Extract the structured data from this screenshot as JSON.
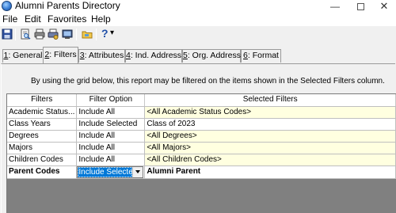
{
  "window": {
    "title": "Alumni Parents Directory",
    "minimize_glyph": "—",
    "close_glyph": "✕"
  },
  "menu": {
    "items": [
      "File",
      "Edit",
      "Favorites",
      "Help"
    ]
  },
  "toolbar": {
    "icons": [
      "save-icon",
      "print-preview-icon",
      "print-icon",
      "print-setup-icon",
      "export-icon",
      "folder-icon",
      "help-icon",
      "dropdown-arrow-icon"
    ],
    "help_glyph": "?",
    "dropdown_glyph": "▾"
  },
  "tabs": [
    {
      "key": "1",
      "label": ": General"
    },
    {
      "key": "2",
      "label": ": Filters"
    },
    {
      "key": "3",
      "label": ": Attributes"
    },
    {
      "key": "4",
      "label": ": Ind. Address"
    },
    {
      "key": "5",
      "label": ": Org. Address"
    },
    {
      "key": "6",
      "label": ": Format"
    }
  ],
  "active_tab_index": 1,
  "instruction": "By using the grid below, this report may be filtered on the items shown in the Selected Filters column.",
  "grid": {
    "headers": [
      "Filters",
      "Filter Option",
      "Selected Filters"
    ],
    "rows": [
      {
        "filter": "Academic Status...",
        "option": "Include All",
        "selected": "<All Academic Status Codes>",
        "highlight": true
      },
      {
        "filter": "Class Years",
        "option": "Include Selected",
        "selected": "Class of 2023",
        "highlight": false
      },
      {
        "filter": "Degrees",
        "option": "Include All",
        "selected": "<All Degrees>",
        "highlight": true
      },
      {
        "filter": "Majors",
        "option": "Include All",
        "selected": "<All Majors>",
        "highlight": true
      },
      {
        "filter": "Children Codes",
        "option": "Include All",
        "selected": "<All Children Codes>",
        "highlight": true
      },
      {
        "filter": "Parent Codes",
        "option": "Include Selecte",
        "selected": "Alumni Parent",
        "highlight": false,
        "editing": true
      }
    ]
  },
  "colors": {
    "selected_cell_bg": "#ffffe0",
    "edit_highlight": "#0078d7",
    "grid_empty_bg": "#808080"
  }
}
